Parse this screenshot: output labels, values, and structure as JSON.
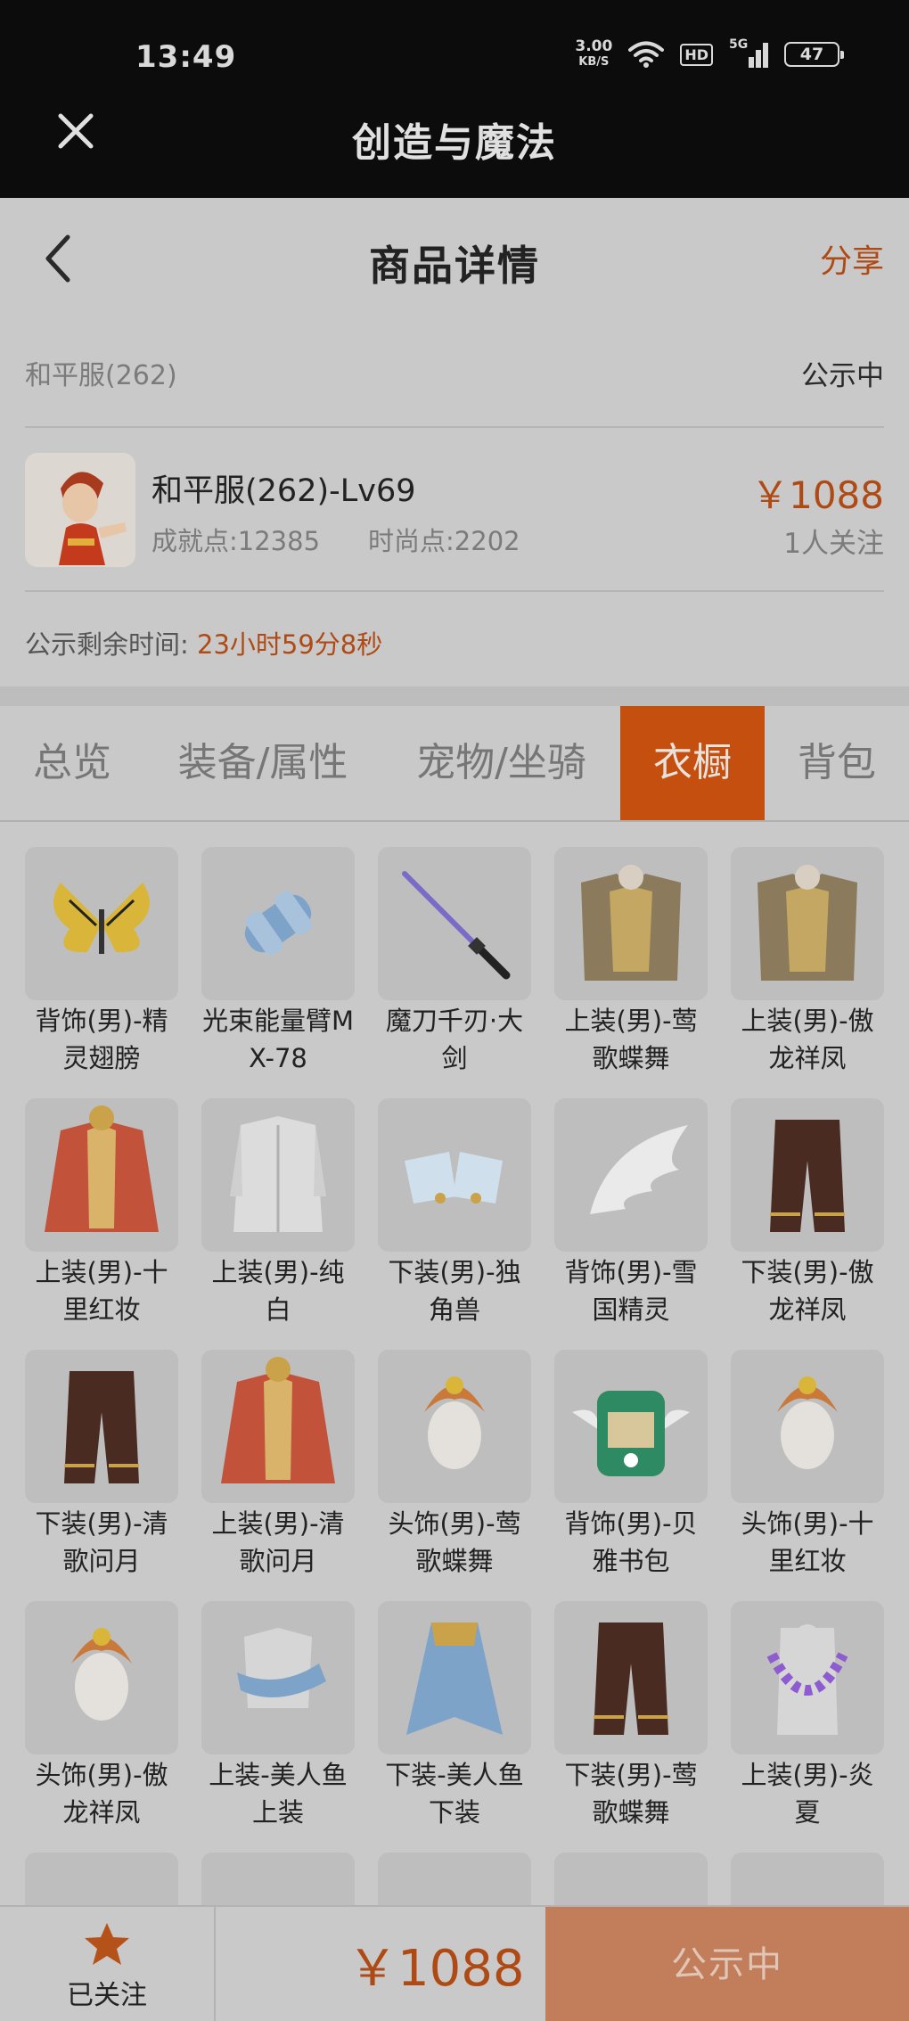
{
  "status_bar": {
    "time": "13:49",
    "speed_value": "3.00",
    "speed_unit": "KB/S",
    "hd": "HD",
    "network": "5G",
    "battery": "47"
  },
  "app_bar": {
    "title": "创造与魔法"
  },
  "header": {
    "title": "商品详情",
    "share": "分享"
  },
  "server": {
    "name": "和平服(262)",
    "status": "公示中"
  },
  "product": {
    "name": "和平服(262)-Lv69",
    "achievement": "成就点:12385",
    "fashion": "时尚点:2202",
    "price": "￥1088",
    "followers": "1人关注"
  },
  "remaining": {
    "label": "公示剩余时间:",
    "time": "23小时59分8秒"
  },
  "tabs": [
    {
      "label": "总览"
    },
    {
      "label": "装备/属性"
    },
    {
      "label": "宠物/坐骑"
    },
    {
      "label": "衣橱",
      "active": true
    },
    {
      "label": "背包"
    }
  ],
  "wardrobe": [
    {
      "label": "背饰(男)-精灵翅膀",
      "icon": "butterfly-wings-icon"
    },
    {
      "label": "光束能量臂MX-78",
      "icon": "energy-arm-icon"
    },
    {
      "label": "魔刀千刃·大剑",
      "icon": "sword-icon"
    },
    {
      "label": "上装(男)-莺歌蝶舞",
      "icon": "armor-icon"
    },
    {
      "label": "上装(男)-傲龙祥凤",
      "icon": "armor-icon"
    },
    {
      "label": "上装(男)-十里红妆",
      "icon": "robe-icon"
    },
    {
      "label": "上装(男)-纯白",
      "icon": "coat-icon"
    },
    {
      "label": "下装(男)-独角兽",
      "icon": "boots-icon"
    },
    {
      "label": "背饰(男)-雪国精灵",
      "icon": "wing-icon"
    },
    {
      "label": "下装(男)-傲龙祥凤",
      "icon": "pants-icon"
    },
    {
      "label": "下装(男)-清歌问月",
      "icon": "pants-icon"
    },
    {
      "label": "上装(男)-清歌问月",
      "icon": "robe-icon"
    },
    {
      "label": "头饰(男)-莺歌蝶舞",
      "icon": "headdress-icon"
    },
    {
      "label": "背饰(男)-贝雅书包",
      "icon": "backpack-icon"
    },
    {
      "label": "头饰(男)-十里红妆",
      "icon": "headdress-icon"
    },
    {
      "label": "头饰(男)-傲龙祥凤",
      "icon": "headdress-icon"
    },
    {
      "label": "上装-美人鱼上装",
      "icon": "top-icon"
    },
    {
      "label": "下装-美人鱼下装",
      "icon": "skirt-icon"
    },
    {
      "label": "下装(男)-莺歌蝶舞",
      "icon": "pants-icon"
    },
    {
      "label": "上装(男)-炎夏",
      "icon": "lei-icon"
    }
  ],
  "colors": {
    "accent": "#c44f0f",
    "price": "#b04a14",
    "buy_button": "#c27e5a"
  },
  "bottom": {
    "watch_label": "已关注",
    "price": "￥1088",
    "buy_label": "公示中"
  }
}
